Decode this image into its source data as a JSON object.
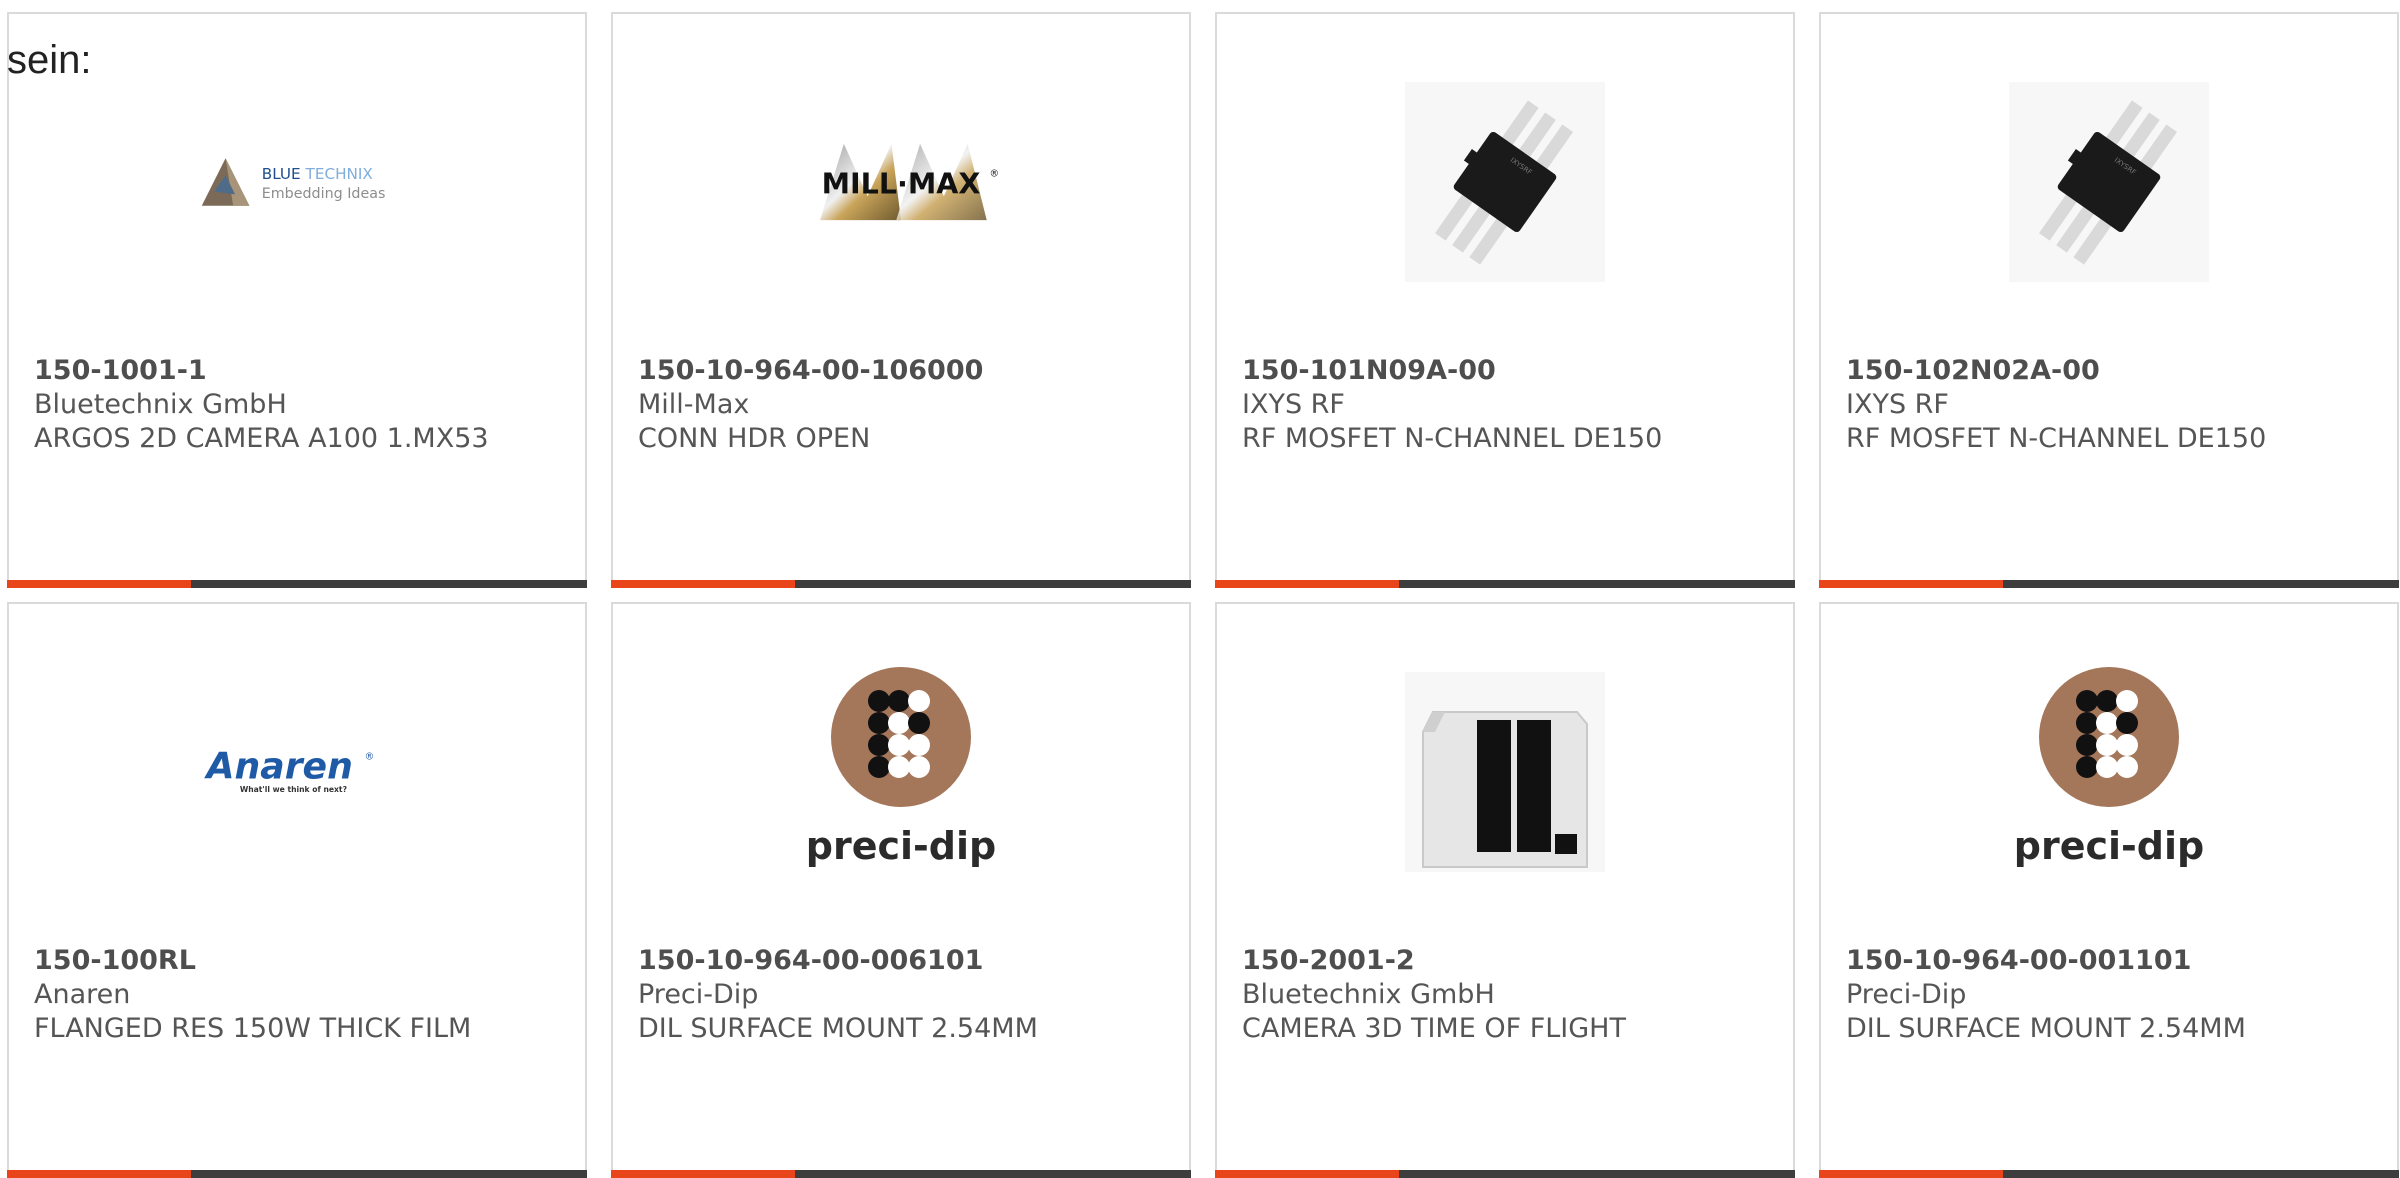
{
  "page": {
    "prefix_text": "sein:"
  },
  "colors": {
    "accent": "#e8461a",
    "bar": "#3d3d3d",
    "border": "#dadada"
  },
  "products": [
    {
      "part_number": "150-1001-1",
      "manufacturer": "Bluetechnix GmbH",
      "description": "ARGOS 2D CAMERA A100 1.MX53",
      "image_icon": "bluetechnix-logo",
      "logo": {
        "brand_blue": "BLUE",
        "brand_tech": "TECHNIX",
        "tagline": "Embedding Ideas"
      }
    },
    {
      "part_number": "150-10-964-00-106000",
      "manufacturer": "Mill-Max",
      "description": "CONN HDR OPEN",
      "image_icon": "mill-max-logo",
      "logo": {
        "brand": "MILL·MAX",
        "mark": "®"
      }
    },
    {
      "part_number": "150-101N09A-00",
      "manufacturer": "IXYS RF",
      "description": "RF MOSFET N-CHANNEL DE150",
      "image_icon": "mosfet-package-image",
      "logo": {
        "chip_label": "IXYSRF"
      }
    },
    {
      "part_number": "150-102N02A-00",
      "manufacturer": "IXYS RF",
      "description": "RF MOSFET N-CHANNEL DE150",
      "image_icon": "mosfet-package-image",
      "logo": {
        "chip_label": "IXYSRF"
      }
    },
    {
      "part_number": "150-100RL",
      "manufacturer": "Anaren",
      "description": "FLANGED RES 150W THICK FILM",
      "image_icon": "anaren-logo",
      "logo": {
        "brand": "Anaren",
        "mark": "®",
        "tagline": "What'll we think of next?"
      }
    },
    {
      "part_number": "150-10-964-00-006101",
      "manufacturer": "Preci-Dip",
      "description": "DIL SURFACE MOUNT 2.54MM",
      "image_icon": "preci-dip-logo",
      "logo": {
        "brand": "preci-dip"
      }
    },
    {
      "part_number": "150-2001-2",
      "manufacturer": "Bluetechnix GmbH",
      "description": "CAMERA 3D TIME OF FLIGHT",
      "image_icon": "tof-camera-image",
      "logo": {}
    },
    {
      "part_number": "150-10-964-00-001101",
      "manufacturer": "Preci-Dip",
      "description": "DIL SURFACE MOUNT 2.54MM",
      "image_icon": "preci-dip-logo",
      "logo": {
        "brand": "preci-dip"
      }
    }
  ]
}
